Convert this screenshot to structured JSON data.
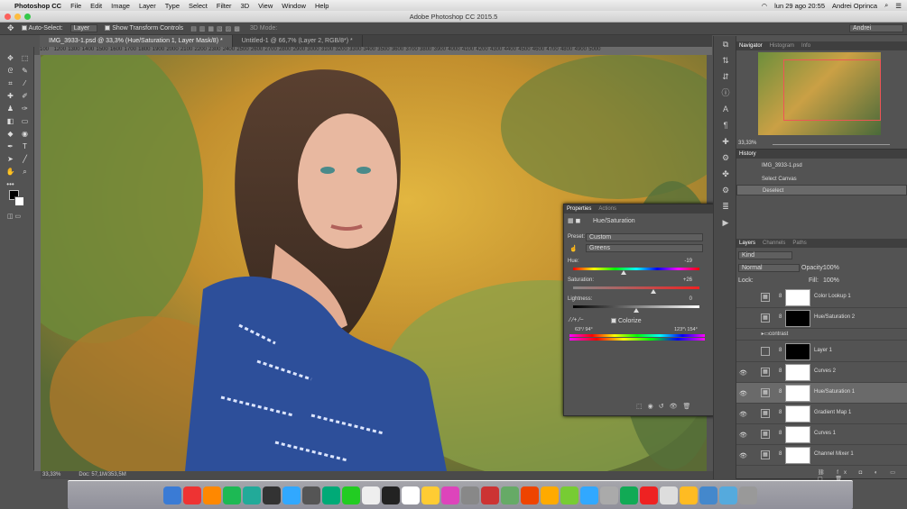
{
  "menubar": {
    "app": "Photoshop CC",
    "items": [
      "File",
      "Edit",
      "Image",
      "Layer",
      "Type",
      "Select",
      "Filter",
      "3D",
      "View",
      "Window",
      "Help"
    ],
    "clock": "lun 29 ago  20:55",
    "user": "Andrei Oprinca"
  },
  "window_title": "Adobe Photoshop CC 2015.5",
  "options": {
    "auto_select_label": "Auto-Select:",
    "auto_select_value": "Layer",
    "transform_label": "Show Transform Controls",
    "mode3d": "3D Mode:",
    "workspace": "Andrei"
  },
  "tabs": [
    "IMG_3933-1.psd @ 33,3% (Hue/Saturation 1, Layer Mask/8) *",
    "Untitled-1 @ 66,7% (Layer 2, RGB/8*) *"
  ],
  "ruler": [
    "100",
    "1200",
    "1300",
    "1400",
    "1500",
    "1600",
    "1700",
    "1800",
    "1900",
    "2000",
    "2100",
    "2200",
    "2300",
    "2400",
    "2500",
    "2600",
    "2700",
    "2800",
    "2900",
    "3000",
    "3100",
    "3200",
    "3300",
    "3400",
    "3500",
    "3600",
    "3700",
    "3800",
    "3900",
    "4000",
    "4100",
    "4200",
    "4300",
    "4400",
    "4500",
    "4600",
    "4700",
    "4800",
    "4900",
    "5000"
  ],
  "status": {
    "zoom": "33,33%",
    "doc": "Doc: 57,1M/353,5M"
  },
  "navigator": {
    "tabs": [
      "Navigator",
      "Histogram",
      "Info"
    ],
    "zoom": "33,33%"
  },
  "history": {
    "title": "History",
    "items": [
      "IMG_3933-1.psd",
      "Select Canvas",
      "Deselect"
    ]
  },
  "properties": {
    "tabs": [
      "Properties",
      "Actions"
    ],
    "title": "Hue/Saturation",
    "preset_label": "Preset:",
    "preset": "Custom",
    "channel": "Greens",
    "hue_label": "Hue:",
    "hue": "-19",
    "sat_label": "Saturation:",
    "sat": "+26",
    "light_label": "Lightness:",
    "light": "0",
    "colorize": "Colorize",
    "range_left": "63°/ 94°",
    "range_right": "123°\\ 154°"
  },
  "layers": {
    "tabs": [
      "Layers",
      "Channels",
      "Paths"
    ],
    "kind": "Kind",
    "blend": "Normal",
    "opacity_label": "Opacity:",
    "opacity": "100%",
    "lock_label": "Lock:",
    "fill_label": "Fill:",
    "fill": "100%",
    "rows": [
      {
        "name": "Color Lookup 1",
        "visible": false
      },
      {
        "name": "Hue/Saturation 2",
        "visible": false
      },
      {
        "name": "contrast",
        "visible": false
      },
      {
        "name": "Layer 1",
        "visible": false
      },
      {
        "name": "Curves 2",
        "visible": true
      },
      {
        "name": "Hue/Saturation 1",
        "visible": true
      },
      {
        "name": "Gradient Map 1",
        "visible": true
      },
      {
        "name": "Curves 1",
        "visible": true
      },
      {
        "name": "Channel Mixer 1",
        "visible": true
      }
    ]
  }
}
